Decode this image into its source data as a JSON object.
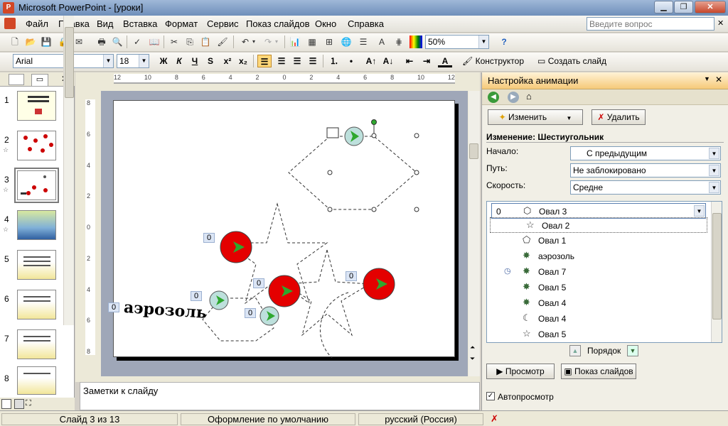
{
  "window": {
    "title": "Microsoft PowerPoint - [уроки]"
  },
  "menu": {
    "items": [
      "Файл",
      "Правка",
      "Вид",
      "Вставка",
      "Формат",
      "Сервис",
      "Показ слайдов",
      "Окно",
      "Справка"
    ],
    "help_placeholder": "Введите вопрос"
  },
  "toolbar": {
    "zoom": "50%",
    "font": "Arial",
    "size": "18",
    "designer": "Конструктор",
    "new_slide": "Создать слайд"
  },
  "ruler": {
    "h_labels": [
      "12",
      "10",
      "8",
      "6",
      "4",
      "2",
      "0",
      "2",
      "4",
      "6",
      "8",
      "10",
      "12"
    ],
    "v_labels": [
      "8",
      "6",
      "4",
      "2",
      "0",
      "2",
      "4",
      "6",
      "8"
    ]
  },
  "slides": [
    {
      "num": "1",
      "star": false
    },
    {
      "num": "2",
      "star": true
    },
    {
      "num": "3",
      "star": true,
      "selected": true
    },
    {
      "num": "4",
      "star": true
    },
    {
      "num": "5",
      "star": false
    },
    {
      "num": "6",
      "star": false
    },
    {
      "num": "7",
      "star": false
    },
    {
      "num": "8",
      "star": false
    }
  ],
  "slide": {
    "text": "аэрозоль",
    "tags": [
      "0",
      "0",
      "0",
      "0",
      "0",
      "0",
      "0"
    ]
  },
  "notes": {
    "text": "Заметки к слайду"
  },
  "taskpane": {
    "title": "Настройка анимации",
    "change_button": "Изменить",
    "delete_button": "Удалить",
    "effect_heading": "Изменение: Шестиугольник",
    "start_label": "Начало:",
    "start_value": "С предыдущим",
    "path_label": "Путь:",
    "path_value": "Не заблокировано",
    "speed_label": "Скорость:",
    "speed_value": "Средне",
    "effects": [
      {
        "num": "0",
        "icon": "hexagon-icon",
        "glyph": "⬡",
        "label": "Овал 3",
        "clock": false
      },
      {
        "num": "",
        "icon": "star-outline-icon",
        "glyph": "☆",
        "label": "Овал 2",
        "clock": false
      },
      {
        "num": "",
        "icon": "pentagon-outline-icon",
        "glyph": "⬠",
        "label": "Овал 1",
        "clock": false
      },
      {
        "num": "",
        "icon": "green-star-icon",
        "glyph": "✸",
        "label": "аэрозоль",
        "clock": false
      },
      {
        "num": "",
        "icon": "green-star-icon",
        "glyph": "✸",
        "label": "Овал 7",
        "clock": true
      },
      {
        "num": "",
        "icon": "green-star-icon",
        "glyph": "✸",
        "label": "Овал 5",
        "clock": false
      },
      {
        "num": "",
        "icon": "green-star-icon",
        "glyph": "✸",
        "label": "Овал 4",
        "clock": false
      },
      {
        "num": "",
        "icon": "crescent-icon",
        "glyph": "☾",
        "label": "Овал 4",
        "clock": false
      },
      {
        "num": "",
        "icon": "star-outline-icon",
        "glyph": "☆",
        "label": "Овал 5",
        "clock": false
      }
    ],
    "order_label": "Порядок",
    "preview_button": "Просмотр",
    "slideshow_button": "Показ слайдов",
    "autopreview_label": "Автопросмотр"
  },
  "status": {
    "slide": "Слайд 3 из 13",
    "design": "Оформление по умолчанию",
    "language": "русский (Россия)"
  }
}
